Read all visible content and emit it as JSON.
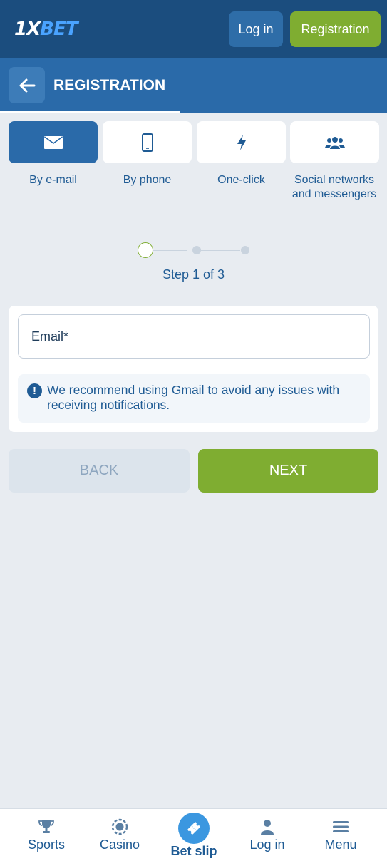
{
  "header": {
    "logo_prefix": "1X",
    "logo_suffix": "BET",
    "login_label": "Log in",
    "registration_label": "Registration"
  },
  "page": {
    "title": "REGISTRATION"
  },
  "methods": [
    {
      "label": "By e-mail",
      "icon": "envelope-icon",
      "active": true
    },
    {
      "label": "By phone",
      "icon": "phone-icon",
      "active": false
    },
    {
      "label": "One-click",
      "icon": "lightning-icon",
      "active": false
    },
    {
      "label": "Social networks and messengers",
      "icon": "users-icon",
      "active": false
    }
  ],
  "stepper": {
    "text": "Step 1 of 3",
    "current": 1,
    "total": 3
  },
  "form": {
    "email_placeholder": "Email*",
    "email_value": "",
    "notice_text": "We recommend using Gmail to avoid any issues with receiving notifications."
  },
  "actions": {
    "back_label": "BACK",
    "next_label": "NEXT"
  },
  "bottom_nav": [
    {
      "label": "Sports",
      "icon": "trophy-icon"
    },
    {
      "label": "Casino",
      "icon": "casino-chip-icon"
    },
    {
      "label": "Bet slip",
      "icon": "ticket-icon"
    },
    {
      "label": "Log in",
      "icon": "user-icon"
    },
    {
      "label": "Menu",
      "icon": "menu-icon"
    }
  ],
  "colors": {
    "header_bg": "#1b4d7e",
    "title_bg": "#2a6aa9",
    "accent_green": "#7fad31",
    "text_blue": "#1f5b94",
    "page_bg": "#e8ecf1"
  }
}
